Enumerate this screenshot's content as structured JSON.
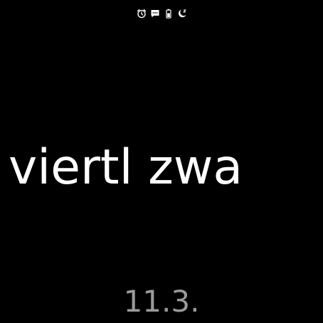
{
  "status_bar": {
    "icons": [
      "alarm-clock-icon",
      "message-icon",
      "battery-icon",
      "sleep-icon"
    ]
  },
  "watchface": {
    "time_words": "viertl zwa",
    "date": "11.3."
  },
  "colors": {
    "background": "#000000",
    "time_text": "#ffffff",
    "date_text": "#9a9a9a",
    "status_icons": "#ffffff"
  }
}
